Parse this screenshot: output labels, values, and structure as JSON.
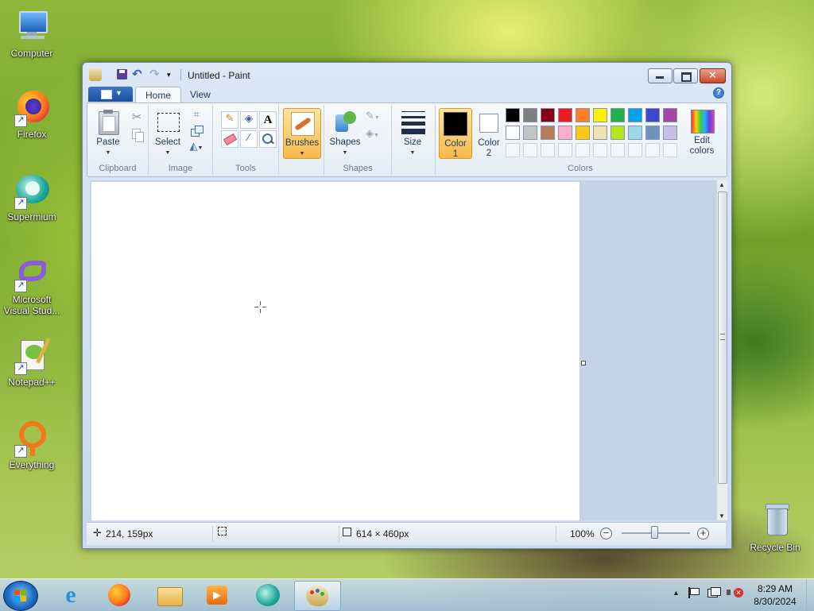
{
  "desktop": {
    "icons": [
      {
        "label": "Computer"
      },
      {
        "label": "Firefox"
      },
      {
        "label": "Supermium"
      },
      {
        "label": "Microsoft Visual Stud..."
      },
      {
        "label": "Notepad++"
      },
      {
        "label": "Everything"
      },
      {
        "label": "Recycle Bin"
      }
    ]
  },
  "window": {
    "title": "Untitled - Paint",
    "tabs": [
      {
        "label": "Home"
      },
      {
        "label": "View"
      }
    ],
    "help_label": "?"
  },
  "ribbon": {
    "clipboard": {
      "paste_label": "Paste",
      "group_label": "Clipboard"
    },
    "image": {
      "select_label": "Select",
      "group_label": "Image"
    },
    "tools": {
      "group_label": "Tools",
      "text_tool": "A"
    },
    "brushes": {
      "label": "Brushes"
    },
    "shapes": {
      "label": "Shapes",
      "group_label": "Shapes"
    },
    "size": {
      "label": "Size"
    },
    "color1": {
      "label": "Color",
      "num": "1",
      "value": "#000000"
    },
    "color2": {
      "label": "Color",
      "num": "2",
      "value": "#ffffff"
    },
    "colors": {
      "group_label": "Colors",
      "edit_label_1": "Edit",
      "edit_label_2": "colors",
      "palette_row1": [
        "#000000",
        "#7f7f7f",
        "#880015",
        "#ed1c24",
        "#ff7f27",
        "#fff200",
        "#22b14c",
        "#00a2e8",
        "#3f48cc",
        "#a349a4"
      ],
      "palette_row2": [
        "#ffffff",
        "#c3c3c3",
        "#b97a57",
        "#ffaec9",
        "#ffc90e",
        "#efe4b0",
        "#b5e61d",
        "#99d9ea",
        "#7092be",
        "#c8bfe7"
      ]
    }
  },
  "status": {
    "cursor_pos": "214, 159px",
    "canvas_size": "614 × 460px",
    "zoom": "100%"
  },
  "taskbar": {
    "time": "8:29 AM",
    "date": "8/30/2024"
  }
}
